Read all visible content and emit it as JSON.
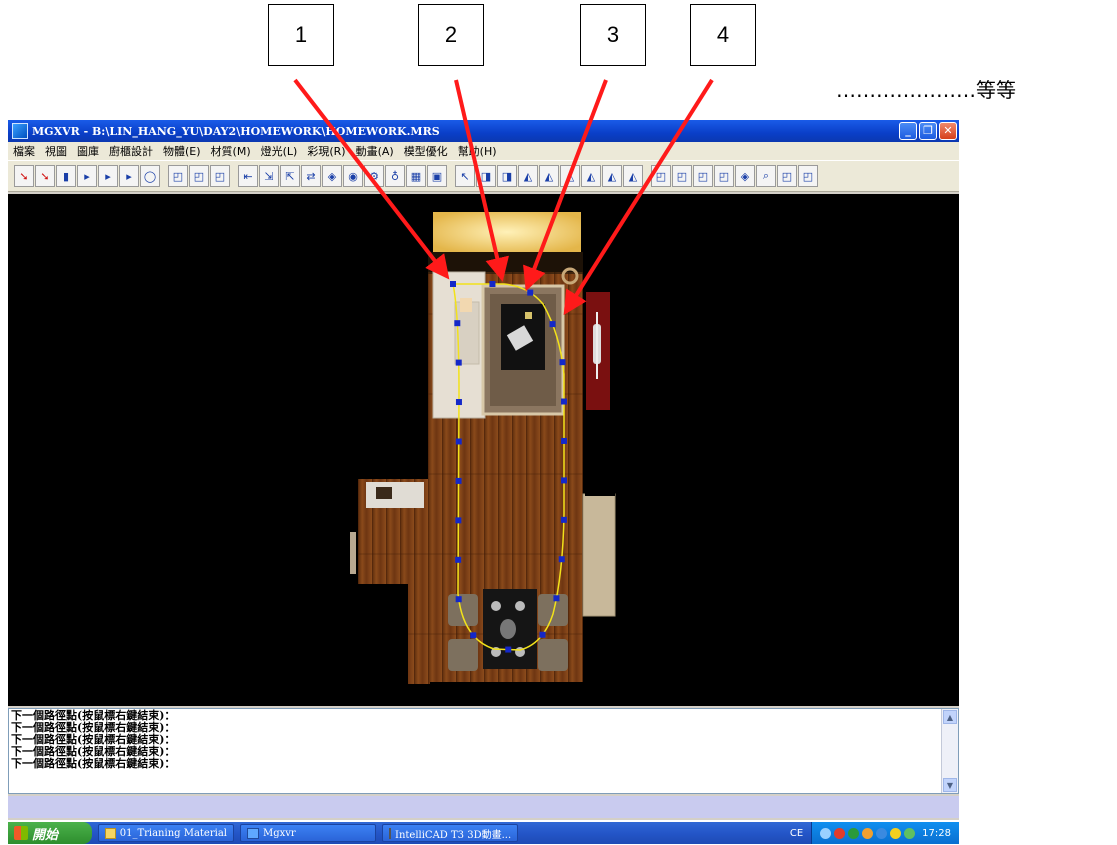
{
  "callouts": [
    "1",
    "2",
    "3",
    "4"
  ],
  "etc_text": "…………………等等",
  "window": {
    "title": "MGXVR - B:\\LIN_HANG_YU\\DAY2\\HOMEWORK\\HOMEWORK.MRS",
    "controls": {
      "minimize": "_",
      "restore": "❐",
      "close": "✕"
    }
  },
  "menu": [
    "檔案",
    "視圖",
    "圖庫",
    "廚櫃設計",
    "物體(E)",
    "材質(M)",
    "燈光(L)",
    "彩現(R)",
    "動畫(A)",
    "模型優化",
    "幫助(H)"
  ],
  "toolbar": {
    "groups": [
      [
        "➘",
        "➘",
        "▮",
        "▸",
        "▸",
        "▸",
        "◯"
      ],
      [
        "◰",
        "◰",
        "◰"
      ],
      [
        "⇤",
        "⇲",
        "⇱",
        "⇄",
        "◈",
        "◉",
        "⚙",
        "♁",
        "▦",
        "▣"
      ],
      [
        "↖",
        "◨",
        "◨",
        "◭",
        "◭",
        "◭",
        "◭",
        "◭",
        "◭"
      ],
      [
        "◰",
        "◰",
        "◰",
        "◰",
        "◈",
        "⌕",
        "◰",
        "◰"
      ]
    ]
  },
  "cmdlog": {
    "lines": [
      "下一個路徑點(按鼠標右鍵結束)：",
      "下一個路徑點(按鼠標右鍵結束)：",
      "下一個路徑點(按鼠標右鍵結束)：",
      "下一個路徑點(按鼠標右鍵結束)：",
      "下一個路徑點(按鼠標右鍵結束)："
    ],
    "scroll_up": "▲",
    "scroll_down": "▼"
  },
  "taskbar": {
    "start_label": "開始",
    "tasks": [
      "01_Trianing Material",
      "Mgxvr",
      "IntelliCAD T3 3D動畫..."
    ],
    "language": "CE",
    "clock": "17:28"
  },
  "colors": {
    "path": "#f2e21a",
    "path_point": "#1428c8",
    "arrow": "#ff1a1a",
    "floor": "#7a3e14",
    "titlebar": "#0a3fc8"
  }
}
